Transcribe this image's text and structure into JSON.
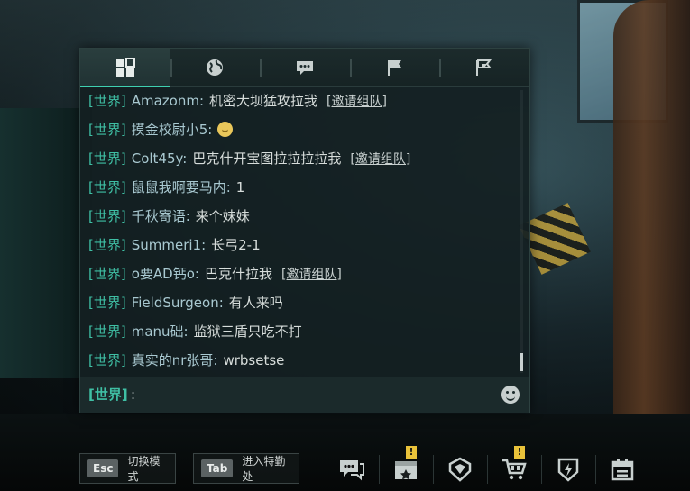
{
  "chat": {
    "tabs": [
      {
        "icon": "grid-icon",
        "active": true
      },
      {
        "icon": "globe-icon",
        "active": false
      },
      {
        "icon": "speech-bubble-icon",
        "active": false
      },
      {
        "icon": "flag-icon",
        "active": false
      },
      {
        "icon": "double-flag-icon",
        "active": false
      }
    ],
    "messages": [
      {
        "channel": "[世界]",
        "user": "Amazonm",
        "text": "机密大坝猛攻拉我",
        "invite": "[邀请组队]"
      },
      {
        "channel": "[世界]",
        "user": "摸金校尉小5",
        "text": "",
        "emoji": "grin-emoji"
      },
      {
        "channel": "[世界]",
        "user": "Colt45y",
        "text": "巴克什开宝图拉拉拉拉我",
        "invite": "[邀请组队]"
      },
      {
        "channel": "[世界]",
        "user": "鼠鼠我啊要马内",
        "text": "1"
      },
      {
        "channel": "[世界]",
        "user": "千秋寄语",
        "text": "来个妹妹"
      },
      {
        "channel": "[世界]",
        "user": "Summeri1",
        "text": "长弓2-1"
      },
      {
        "channel": "[世界]",
        "user": "o要AD钙o",
        "text": "巴克什拉我",
        "invite": "[邀请组队]"
      },
      {
        "channel": "[世界]",
        "user": "FieldSurgeon",
        "text": "有人来吗"
      },
      {
        "channel": "[世界]",
        "user": "manu础",
        "text": "监狱三盾只吃不打"
      },
      {
        "channel": "[世界]",
        "user": "真实的nr张哥",
        "text": "wrbsetse"
      }
    ],
    "input": {
      "channel": "[世界]",
      "separator": ":",
      "value": ""
    },
    "scroll_position": 1.0
  },
  "bottom_bar": {
    "esc_hint": {
      "key": "Esc",
      "label": "切换模式"
    },
    "tab_hint": {
      "key": "Tab",
      "label": "进入特勤处"
    },
    "menu": [
      {
        "icon": "chat-icon",
        "alert": false
      },
      {
        "icon": "gift-box-icon",
        "alert": true,
        "badge": "!"
      },
      {
        "icon": "shield-badge-icon",
        "alert": false
      },
      {
        "icon": "shopping-cart-icon",
        "alert": true,
        "badge": "!"
      },
      {
        "icon": "lightning-shield-icon",
        "alert": false
      },
      {
        "icon": "calendar-icon",
        "alert": false
      }
    ]
  },
  "colors": {
    "channel": "#3fbfa4",
    "username": "#a9c9d1",
    "message_text": "#d7dddb",
    "alert": "#e9c23a"
  }
}
